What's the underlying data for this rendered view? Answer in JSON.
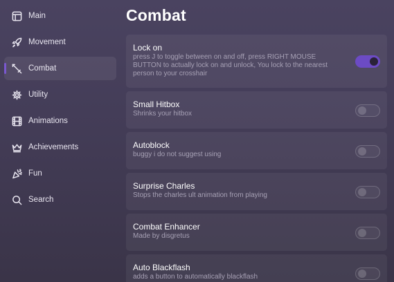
{
  "sidebar": {
    "items": [
      {
        "label": "Main",
        "icon": "window-icon",
        "active": false
      },
      {
        "label": "Movement",
        "icon": "rocket-icon",
        "active": false
      },
      {
        "label": "Combat",
        "icon": "sword-icon",
        "active": true
      },
      {
        "label": "Utility",
        "icon": "gear-icon",
        "active": false
      },
      {
        "label": "Animations",
        "icon": "film-icon",
        "active": false
      },
      {
        "label": "Achievements",
        "icon": "crown-icon",
        "active": false
      },
      {
        "label": "Fun",
        "icon": "party-popper-icon",
        "active": false
      },
      {
        "label": "Search",
        "icon": "search-icon",
        "active": false
      }
    ]
  },
  "main": {
    "title": "Combat",
    "settings": [
      {
        "title": "Lock on",
        "description": "press J to toggle between on and off, press RIGHT MOUSE BUTTON to actually lock on and unlock, You lock to the nearest person to your crosshair",
        "enabled": true
      },
      {
        "title": "Small Hitbox",
        "description": "Shrinks your hitbox",
        "enabled": false
      },
      {
        "title": "Autoblock",
        "description": "buggy i do not suggest using",
        "enabled": false
      },
      {
        "title": "Surprise Charles",
        "description": "Stops the charles ult animation from playing",
        "enabled": false
      },
      {
        "title": "Combat Enhancer",
        "description": "Made by disgretus",
        "enabled": false
      },
      {
        "title": "Auto Blackflash",
        "description": "adds a button to automatically blackflash",
        "enabled": false
      }
    ]
  },
  "colors": {
    "accent": "#6c4bc4",
    "background": "#463f5a",
    "card": "#514a64",
    "muted_text": "#a7a1b5"
  }
}
